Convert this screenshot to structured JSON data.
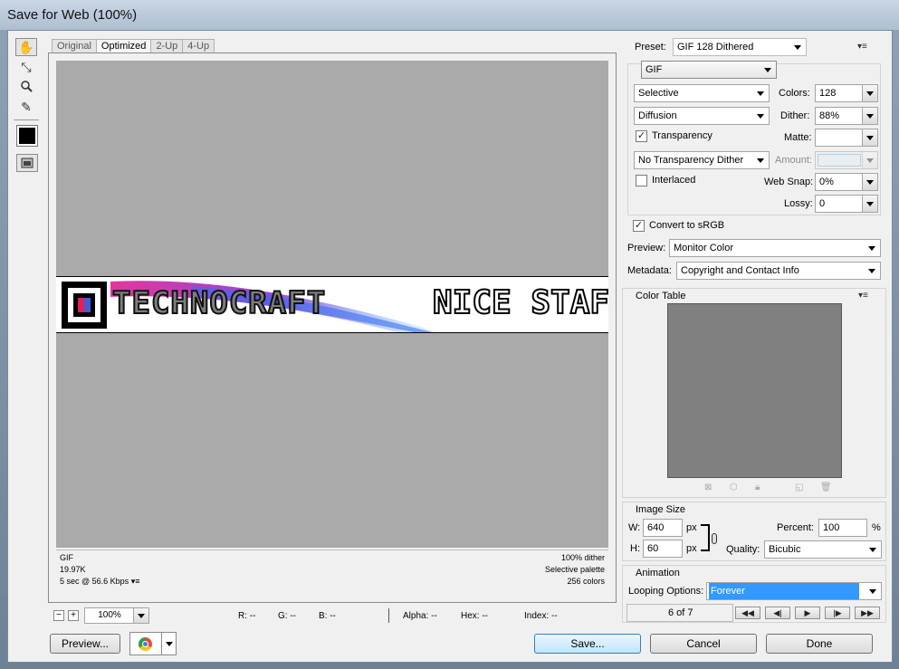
{
  "window": {
    "title": "Save for Web (100%)"
  },
  "tools": [
    {
      "name": "hand-tool",
      "glyph": "✋"
    },
    {
      "name": "slice-select-tool",
      "glyph": "⤡"
    },
    {
      "name": "zoom-tool",
      "glyph": "🔍"
    },
    {
      "name": "eyedropper-tool",
      "glyph": "✎"
    }
  ],
  "view_tabs": [
    "Original",
    "Optimized",
    "2-Up",
    "4-Up"
  ],
  "banner": {
    "logo_text": "TECHNOCRAFT",
    "tag_text": "NICE STAFF"
  },
  "info_left": [
    "GIF",
    "19.97K",
    "5 sec @ 56.6 Kbps"
  ],
  "info_right": [
    "100% dither",
    "Selective palette",
    "256 colors"
  ],
  "status": {
    "zoom": "100%",
    "r": "R: --",
    "g": "G: --",
    "b": "B: --",
    "alpha": "Alpha: --",
    "hex": "Hex: --",
    "index": "Index: --"
  },
  "settings": {
    "preset_label": "Preset:",
    "preset": "GIF 128 Dithered",
    "format": "GIF",
    "reduction": "Selective",
    "colors_label": "Colors:",
    "colors": "128",
    "dither_algo": "Diffusion",
    "dither_label": "Dither:",
    "dither": "88%",
    "transparency": "Transparency",
    "matte_label": "Matte:",
    "matte": "",
    "transparency_dither": "No Transparency Dither",
    "amount_label": "Amount:",
    "amount": "",
    "interlaced": "Interlaced",
    "websnap_label": "Web Snap:",
    "websnap": "0%",
    "lossy_label": "Lossy:",
    "lossy": "0",
    "convert_srgb": "Convert to sRGB",
    "preview_label": "Preview:",
    "preview": "Monitor Color",
    "metadata_label": "Metadata:",
    "metadata": "Copyright and Contact Info"
  },
  "color_table": {
    "title": "Color Table"
  },
  "image_size": {
    "title": "Image Size",
    "w_label": "W:",
    "w": "640",
    "h_label": "H:",
    "h": "60",
    "px": "px",
    "percent_label": "Percent:",
    "percent": "100",
    "pct": "%",
    "quality_label": "Quality:",
    "quality": "Bicubic"
  },
  "animation": {
    "title": "Animation",
    "looping_label": "Looping Options:",
    "looping": "Forever",
    "frame": "6 of 7"
  },
  "buttons": {
    "preview": "Preview...",
    "save": "Save...",
    "cancel": "Cancel",
    "done": "Done"
  },
  "colors": {
    "canvas": "#aaaaaa",
    "swatch": "#808080",
    "selection": "#3399ff"
  }
}
